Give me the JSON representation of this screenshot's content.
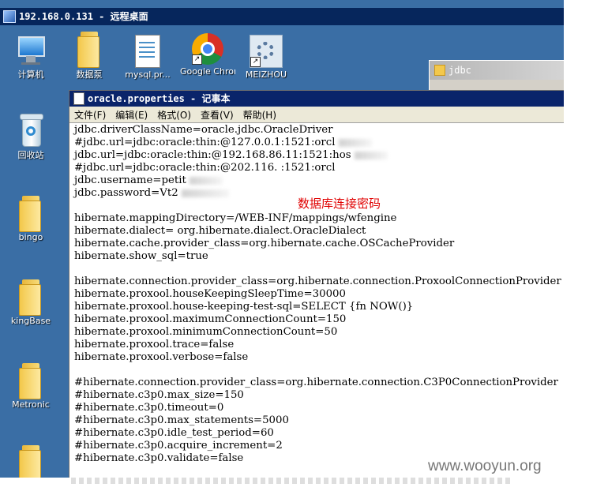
{
  "window": {
    "title": "192.168.0.131 - 远程桌面"
  },
  "desktop": {
    "icons": [
      {
        "label": "计算机"
      },
      {
        "label": "数据泵"
      },
      {
        "label": "mysql.pr..."
      },
      {
        "label": "Google Chrome"
      },
      {
        "label": "MEIZHOU"
      },
      {
        "label": "回收站"
      },
      {
        "label": "bingo"
      },
      {
        "label": "kingBase"
      },
      {
        "label": "Metronic"
      }
    ],
    "jdbc_window_title": "jdbc"
  },
  "notepad": {
    "title": "oracle.properties - 记事本",
    "menu": [
      "文件(F)",
      "编辑(E)",
      "格式(O)",
      "查看(V)",
      "帮助(H)"
    ],
    "lines": [
      "jdbc.driverClassName=oracle.jdbc.OracleDriver",
      "#jdbc.url=jdbc:oracle:thin:@127.0.0.1:1521:orcl",
      "jdbc.url=jdbc:oracle:thin:@192.168.86.11:1521:hos",
      "#jdbc.url=jdbc:oracle:thin:@202.116.   :1521:orcl",
      "jdbc.username=petit",
      "jdbc.password=Vt2",
      "",
      "hibernate.mappingDirectory=/WEB-INF/mappings/wfengine",
      "hibernate.dialect= org.hibernate.dialect.OracleDialect",
      "hibernate.cache.provider_class=org.hibernate.cache.OSCacheProvider",
      "hibernate.show_sql=true",
      "",
      "hibernate.connection.provider_class=org.hibernate.connection.ProxoolConnectionProvider",
      "hibernate.proxool.houseKeepingSleepTime=30000",
      "hibernate.proxool.house-keeping-test-sql=SELECT {fn NOW()}",
      "hibernate.proxool.maximumConnectionCount=150",
      "hibernate.proxool.minimumConnectionCount=50",
      "hibernate.proxool.trace=false",
      "hibernate.proxool.verbose=false",
      "",
      "#hibernate.connection.provider_class=org.hibernate.connection.C3P0ConnectionProvider",
      "#hibernate.c3p0.max_size=150",
      "#hibernate.c3p0.timeout=0",
      "#hibernate.c3p0.max_statements=5000",
      "#hibernate.c3p0.idle_test_period=60",
      "#hibernate.c3p0.acquire_increment=2",
      "#hibernate.c3p0.validate=false"
    ]
  },
  "annotation": "数据库连接密码",
  "watermark": "www.wooyun.org"
}
